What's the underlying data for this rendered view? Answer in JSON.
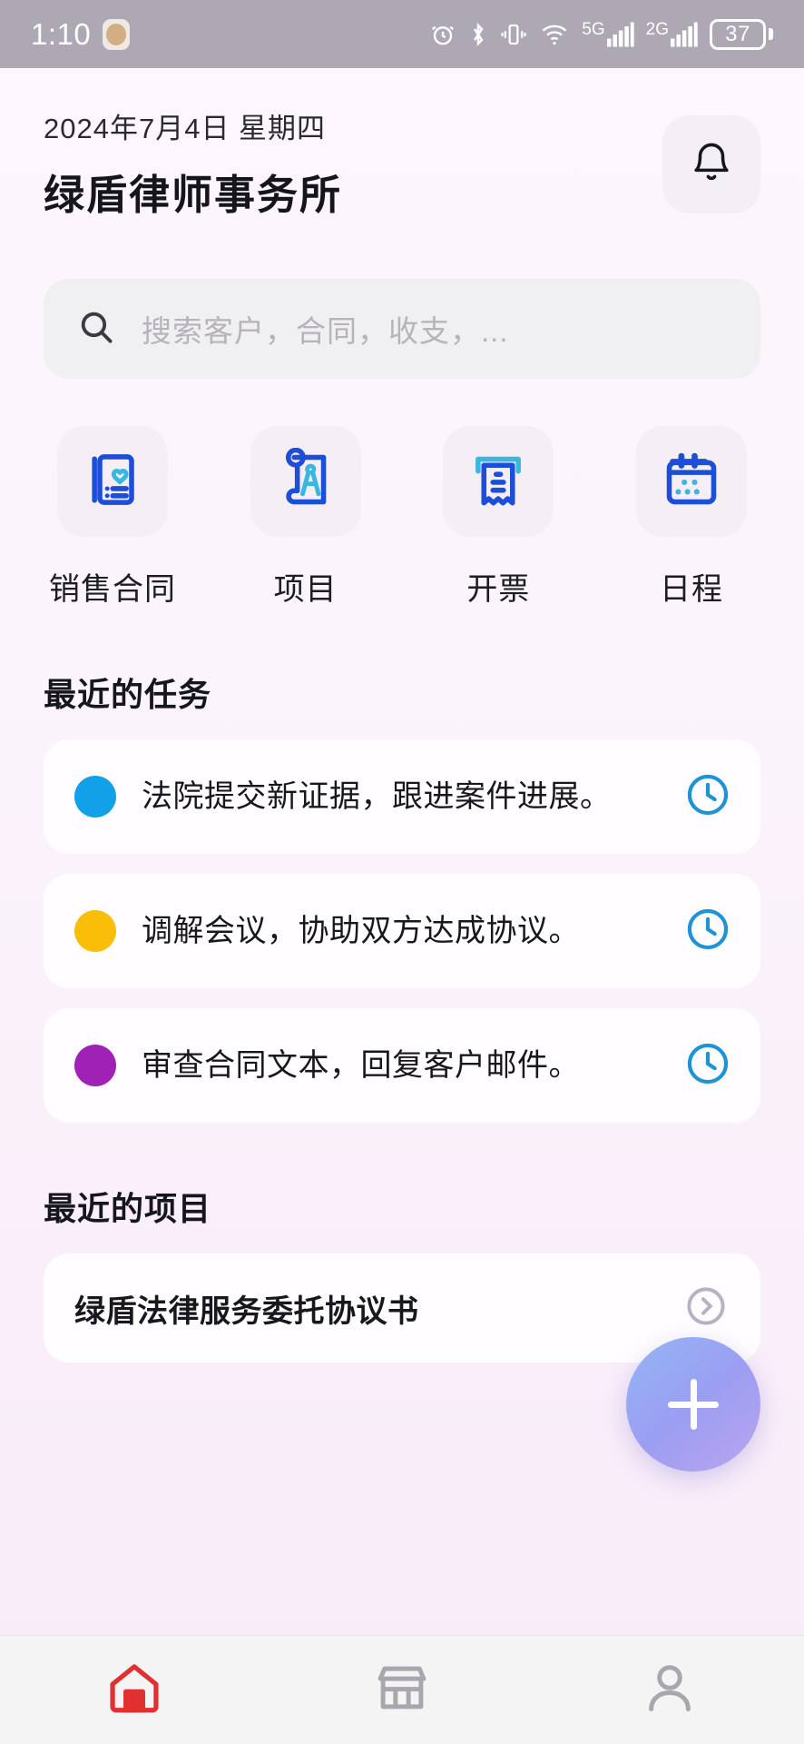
{
  "status_bar": {
    "time": "1:10",
    "battery_percent": "37",
    "icons": [
      "alarm-icon",
      "bluetooth-icon",
      "vibrate-icon",
      "wifi-icon",
      "signal-5g-icon",
      "signal-2g-icon",
      "battery-icon"
    ],
    "network_5g_label": "5G",
    "network_2g_label": "2G",
    "background": "#aea7b4"
  },
  "header": {
    "date": "2024年7月4日 星期四",
    "title": "绿盾律师事务所",
    "notification_button": "bell-icon"
  },
  "search": {
    "placeholder": "搜索客户，合同，收支，...",
    "icon": "search-icon"
  },
  "quick_actions": [
    {
      "label": "销售合同",
      "icon": "contract-heart-icon",
      "color": "#1d4ed8"
    },
    {
      "label": "项目",
      "icon": "blueprint-compass-icon",
      "color": "#1d4ed8"
    },
    {
      "label": "开票",
      "icon": "invoice-receipt-icon",
      "color": "#1d4ed8"
    },
    {
      "label": "日程",
      "icon": "calendar-icon",
      "color": "#1d4ed8"
    }
  ],
  "recent_tasks": {
    "title": "最近的任务",
    "items": [
      {
        "text": "法院提交新证据，跟进案件进展。",
        "dot_color": "#12a0e8",
        "action_icon": "clock-icon"
      },
      {
        "text": "调解会议，协助双方达成协议。",
        "dot_color": "#fbbe08",
        "action_icon": "clock-icon"
      },
      {
        "text": "审查合同文本，回复客户邮件。",
        "dot_color": "#a021b5",
        "action_icon": "clock-icon"
      }
    ]
  },
  "recent_projects": {
    "title": "最近的项目",
    "items": [
      {
        "text": "绿盾法律服务委托协议书",
        "action_icon": "chevron-right-icon"
      }
    ]
  },
  "fab": {
    "icon": "plus-icon",
    "label": "+"
  },
  "bottom_nav": [
    {
      "name": "home",
      "icon": "home-icon",
      "active": true
    },
    {
      "name": "store",
      "icon": "store-icon",
      "active": false
    },
    {
      "name": "profile",
      "icon": "person-icon",
      "active": false
    }
  ],
  "colors": {
    "page_bg": "#fbf4fb",
    "card_bg": "#fffdff",
    "accent_blue": "#1d4ed8",
    "accent_cyan": "#3ab7e0",
    "home_red": "#e03030"
  }
}
